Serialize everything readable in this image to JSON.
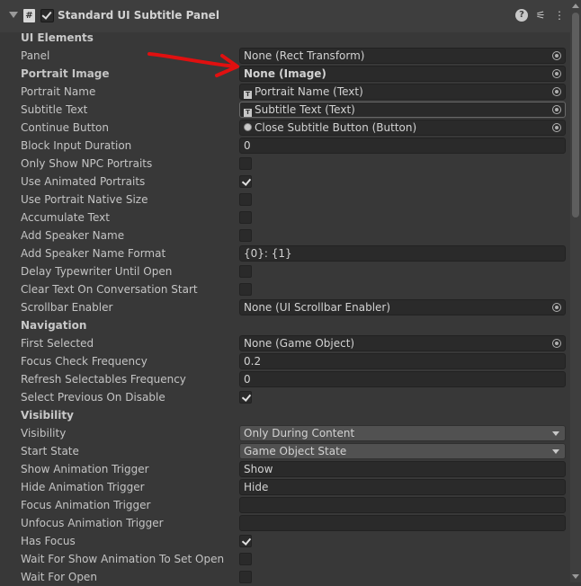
{
  "component": {
    "title": "Standard UI Subtitle Panel",
    "enabled": true
  },
  "sections": {
    "ui_elements": "UI Elements",
    "navigation": "Navigation",
    "visibility": "Visibility"
  },
  "fields": {
    "panel": {
      "label": "Panel",
      "value": "None (Rect Transform)"
    },
    "portrait_image": {
      "label": "Portrait Image",
      "value": "None (Image)"
    },
    "portrait_name": {
      "label": "Portrait Name",
      "value": "Portrait Name (Text)"
    },
    "subtitle_text": {
      "label": "Subtitle Text",
      "value": "Subtitle Text (Text)"
    },
    "continue_button": {
      "label": "Continue Button",
      "value": "Close Subtitle Button (Button)"
    },
    "block_input_duration": {
      "label": "Block Input Duration",
      "value": "0"
    },
    "only_show_npc_portraits": {
      "label": "Only Show NPC Portraits",
      "checked": false
    },
    "use_animated_portraits": {
      "label": "Use Animated Portraits",
      "checked": true
    },
    "use_portrait_native_size": {
      "label": "Use Portrait Native Size",
      "checked": false
    },
    "accumulate_text": {
      "label": "Accumulate Text",
      "checked": false
    },
    "add_speaker_name": {
      "label": "Add Speaker Name",
      "checked": false
    },
    "add_speaker_name_format": {
      "label": "Add Speaker Name Format",
      "value": "{0}: {1}"
    },
    "delay_typewriter_until_open": {
      "label": "Delay Typewriter Until Open",
      "checked": false
    },
    "clear_text_on_conversation_start": {
      "label": "Clear Text On Conversation Start",
      "checked": false
    },
    "scrollbar_enabler": {
      "label": "Scrollbar Enabler",
      "value": "None (UI Scrollbar Enabler)"
    },
    "first_selected": {
      "label": "First Selected",
      "value": "None (Game Object)"
    },
    "focus_check_frequency": {
      "label": "Focus Check Frequency",
      "value": "0.2"
    },
    "refresh_selectables_frequency": {
      "label": "Refresh Selectables Frequency",
      "value": "0"
    },
    "select_previous_on_disable": {
      "label": "Select Previous On Disable",
      "checked": true
    },
    "visibility": {
      "label": "Visibility",
      "value": "Only During Content"
    },
    "start_state": {
      "label": "Start State",
      "value": "Game Object State"
    },
    "show_animation_trigger": {
      "label": "Show Animation Trigger",
      "value": "Show"
    },
    "hide_animation_trigger": {
      "label": "Hide Animation Trigger",
      "value": "Hide"
    },
    "focus_animation_trigger": {
      "label": "Focus Animation Trigger",
      "value": ""
    },
    "unfocus_animation_trigger": {
      "label": "Unfocus Animation Trigger",
      "value": ""
    },
    "has_focus": {
      "label": "Has Focus",
      "checked": true
    },
    "wait_for_show_animation_to_set_open": {
      "label": "Wait For Show Animation To Set Open",
      "checked": false
    },
    "wait_for_open": {
      "label": "Wait For Open",
      "checked": false
    }
  },
  "colors": {
    "background": "#383838",
    "field_bg": "#2a2a2a",
    "annotation_arrow": "#e01010"
  },
  "icons": {
    "foldout": "triangle-down-icon",
    "script": "script-hash-icon",
    "help": "help-icon",
    "presets": "presets-sliders-icon",
    "menu": "kebab-menu-icon",
    "object_picker": "object-picker-icon",
    "text_component": "text-component-icon",
    "button_component": "button-radio-icon"
  }
}
